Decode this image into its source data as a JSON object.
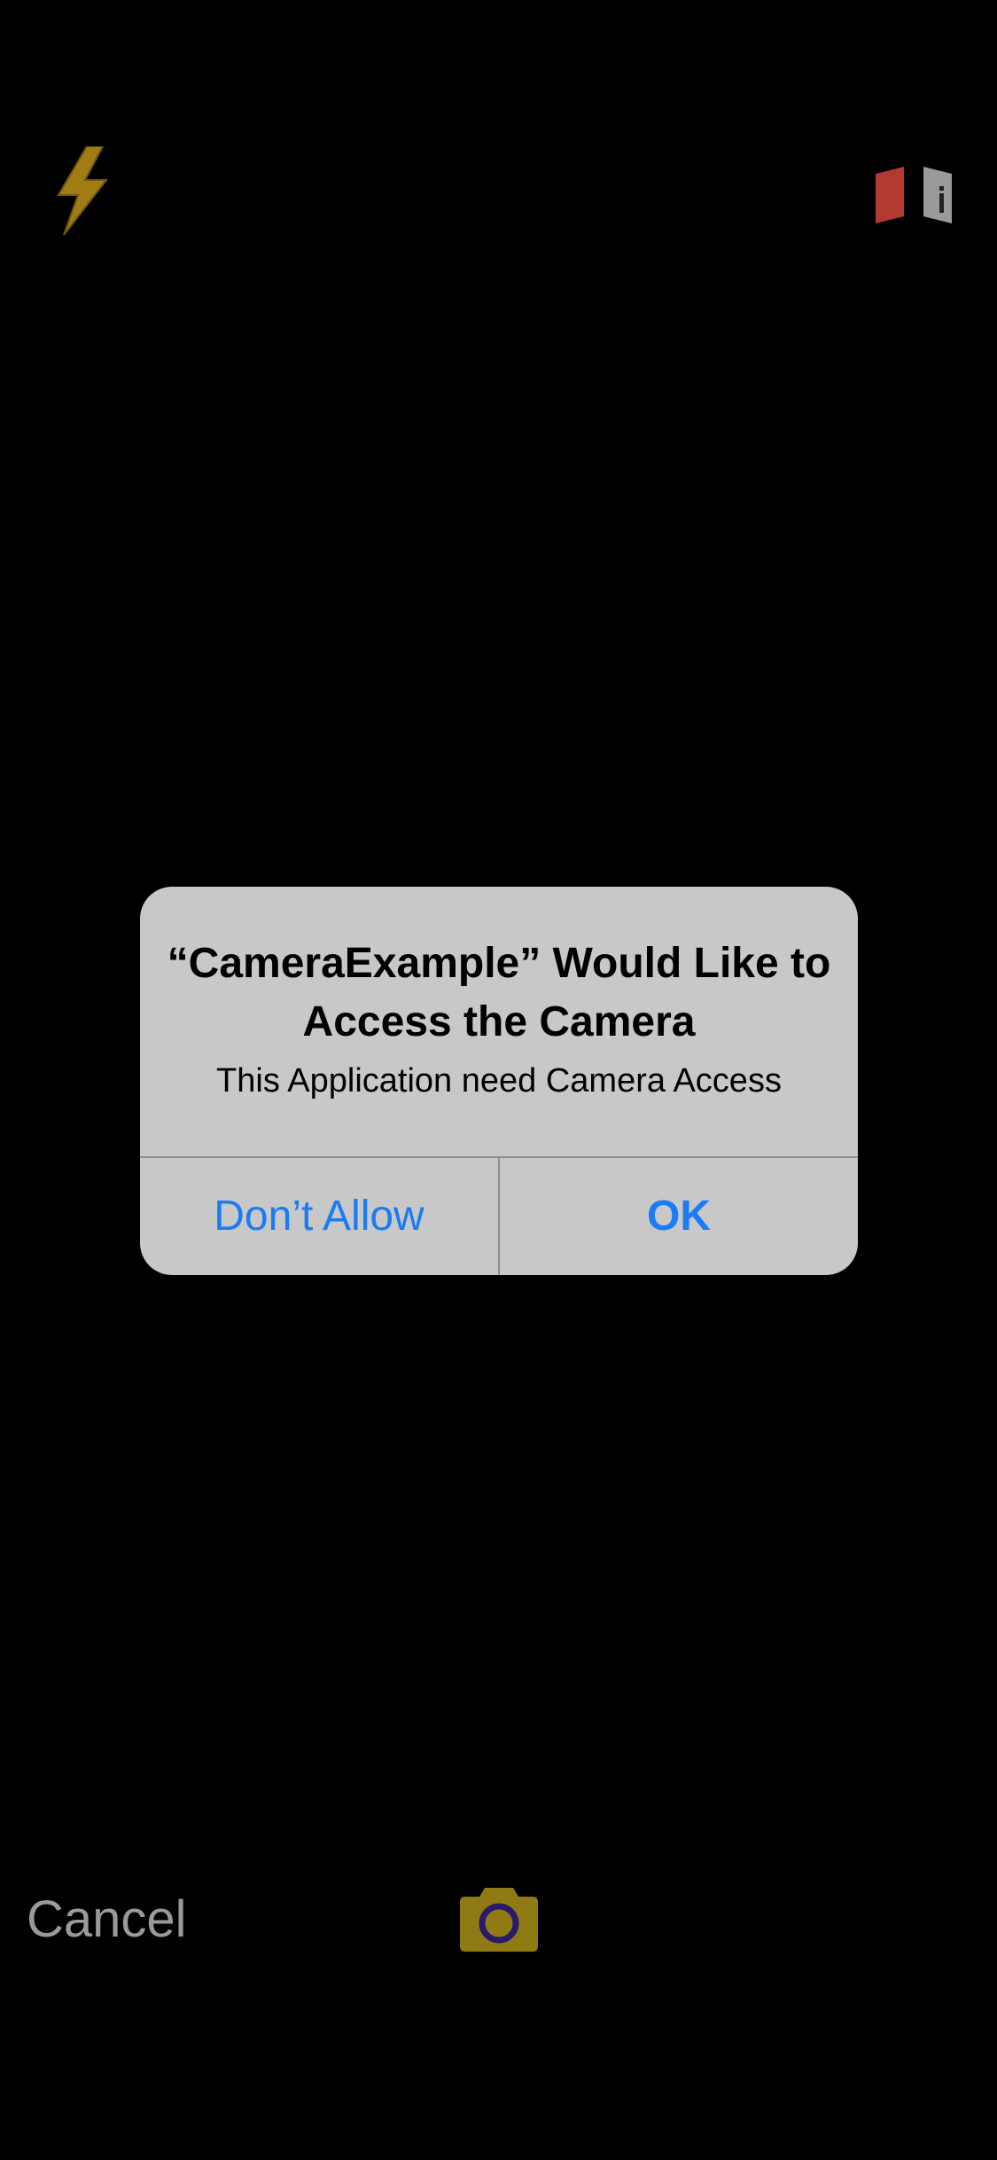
{
  "alert": {
    "title": "“CameraExample” Would Like to Access the Camera",
    "message": "This Application need Camera Access",
    "deny_label": "Don’t Allow",
    "ok_label": "OK"
  },
  "camera_controls": {
    "cancel_label": "Cancel",
    "flash_icon": "flash-icon",
    "flip_icon": "camera-flip-icon",
    "shutter_icon": "camera-shutter-icon"
  },
  "colors": {
    "background": "#000000",
    "alert_background": "#c8c8c8",
    "button_text": "#1a7cf5",
    "flash": "#a07c14",
    "flip_front": "#c0392b",
    "shutter": "#8f7a14",
    "cancel_text": "#9a9a9a"
  }
}
